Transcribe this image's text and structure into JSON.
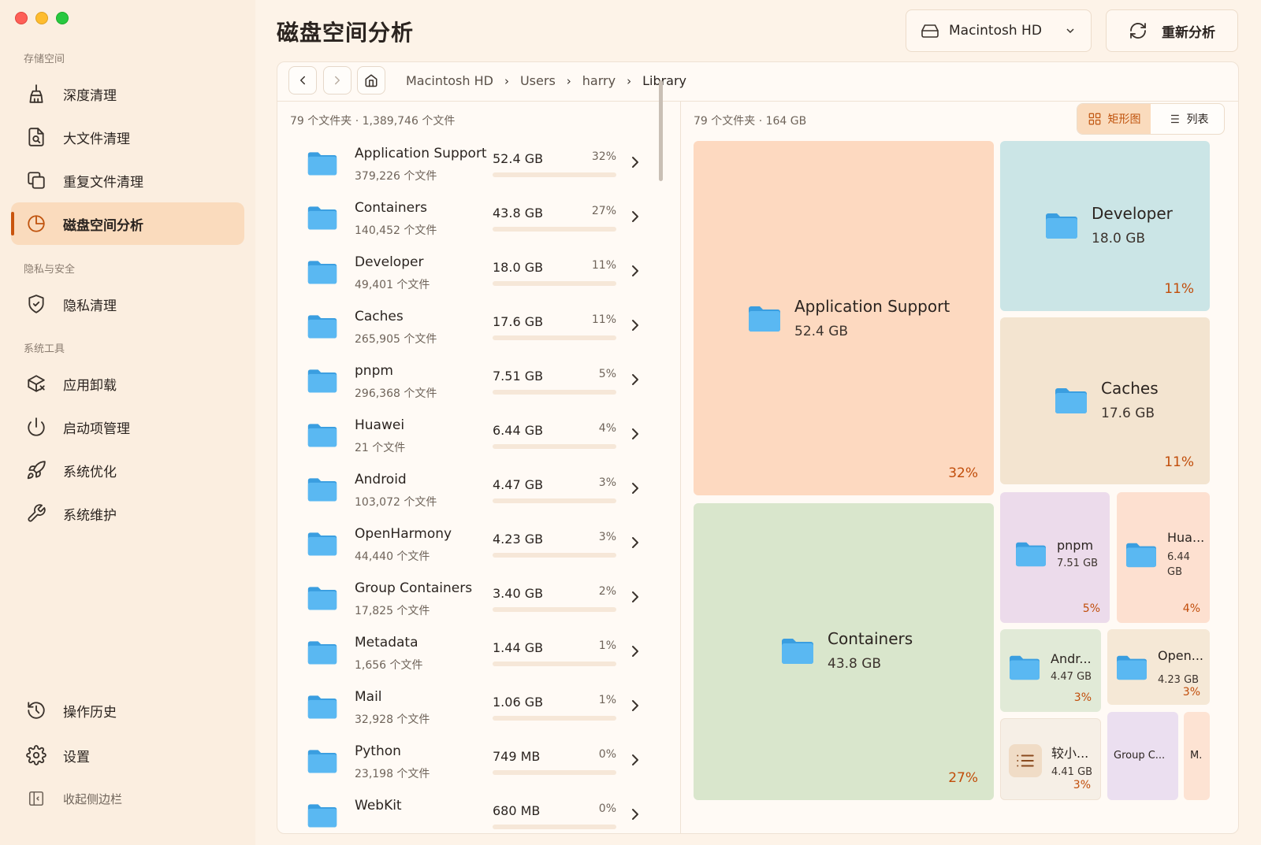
{
  "sidebar": {
    "sections": {
      "storage": "存储空间",
      "privacy": "隐私与安全",
      "tools": "系统工具"
    },
    "items": [
      {
        "label": "深度清理",
        "icon": "broom-icon"
      },
      {
        "label": "大文件清理",
        "icon": "file-search-icon"
      },
      {
        "label": "重复文件清理",
        "icon": "copy-icon"
      },
      {
        "label": "磁盘空间分析",
        "icon": "pie-chart-icon",
        "active": true
      },
      {
        "label": "隐私清理",
        "icon": "shield-check-icon"
      },
      {
        "label": "应用卸载",
        "icon": "package-x-icon"
      },
      {
        "label": "启动项管理",
        "icon": "power-icon"
      },
      {
        "label": "系统优化",
        "icon": "rocket-icon"
      },
      {
        "label": "系统维护",
        "icon": "wrench-icon"
      },
      {
        "label": "操作历史",
        "icon": "history-icon"
      },
      {
        "label": "设置",
        "icon": "gear-icon"
      }
    ],
    "collapse_label": "收起侧边栏"
  },
  "header": {
    "title": "磁盘空间分析",
    "disk": "Macintosh HD",
    "refresh": "重新分析"
  },
  "breadcrumb": [
    "Macintosh HD",
    "Users",
    "harry",
    "Library"
  ],
  "left_summary": "79 个文件夹 · 1,389,746 个文件",
  "right_summary": "79 个文件夹 · 164 GB",
  "view_toggle": {
    "treemap": "矩形图",
    "list": "列表",
    "selected": "treemap"
  },
  "folders": [
    {
      "name": "Application Support",
      "files": "379,226 个文件",
      "size": "52.4 GB",
      "pct": "32%",
      "frac": 0.32
    },
    {
      "name": "Containers",
      "files": "140,452 个文件",
      "size": "43.8 GB",
      "pct": "27%",
      "frac": 0.27
    },
    {
      "name": "Developer",
      "files": "49,401 个文件",
      "size": "18.0 GB",
      "pct": "11%",
      "frac": 0.11
    },
    {
      "name": "Caches",
      "files": "265,905 个文件",
      "size": "17.6 GB",
      "pct": "11%",
      "frac": 0.11
    },
    {
      "name": "pnpm",
      "files": "296,368 个文件",
      "size": "7.51 GB",
      "pct": "5%",
      "frac": 0.05
    },
    {
      "name": "Huawei",
      "files": "21 个文件",
      "size": "6.44 GB",
      "pct": "4%",
      "frac": 0.04
    },
    {
      "name": "Android",
      "files": "103,072 个文件",
      "size": "4.47 GB",
      "pct": "3%",
      "frac": 0.03
    },
    {
      "name": "OpenHarmony",
      "files": "44,440 个文件",
      "size": "4.23 GB",
      "pct": "3%",
      "frac": 0.03
    },
    {
      "name": "Group Containers",
      "files": "17,825 个文件",
      "size": "3.40 GB",
      "pct": "2%",
      "frac": 0.02
    },
    {
      "name": "Metadata",
      "files": "1,656 个文件",
      "size": "1.44 GB",
      "pct": "1%",
      "frac": 0.01
    },
    {
      "name": "Mail",
      "files": "32,928 个文件",
      "size": "1.06 GB",
      "pct": "1%",
      "frac": 0.01
    },
    {
      "name": "Python",
      "files": "23,198 个文件",
      "size": "749 MB",
      "pct": "0%",
      "frac": 0.0
    },
    {
      "name": "WebKit",
      "files": "",
      "size": "680 MB",
      "pct": "0%",
      "frac": 0.0
    }
  ],
  "treemap": {
    "app_support": {
      "name": "Application Support",
      "size": "52.4 GB",
      "pct": "32%"
    },
    "developer": {
      "name": "Developer",
      "size": "18.0 GB",
      "pct": "11%"
    },
    "caches": {
      "name": "Caches",
      "size": "17.6 GB",
      "pct": "11%"
    },
    "containers": {
      "name": "Containers",
      "size": "43.8 GB",
      "pct": "27%"
    },
    "pnpm": {
      "name": "pnpm",
      "size": "7.51 GB",
      "pct": "5%"
    },
    "huawei": {
      "name": "Hua...",
      "size_a": "6.44",
      "size_b": "GB",
      "pct": "4%"
    },
    "android": {
      "name": "Andr...",
      "size": "4.47 GB",
      "pct": "3%"
    },
    "openharmony": {
      "name": "Open...",
      "size": "4.23 GB",
      "pct": "3%"
    },
    "smaller": {
      "name": "较小...",
      "size": "4.41 GB",
      "pct": "3%"
    },
    "group": {
      "name": "Group C..."
    },
    "m": {
      "name": "M."
    }
  },
  "colors": {
    "accent": "#c14d0a",
    "app_support": "#fdd9c0",
    "developer": "#cbe5e6",
    "caches": "#f3e4d0",
    "containers": "#d9e6cc",
    "pnpm": "#ecdbeb",
    "huawei": "#fde0d0",
    "android": "#e1ead7",
    "openharmony": "#f5e8d6",
    "smaller": "#f6efe6",
    "group": "#ebdff0",
    "m": "#fde3d3"
  }
}
